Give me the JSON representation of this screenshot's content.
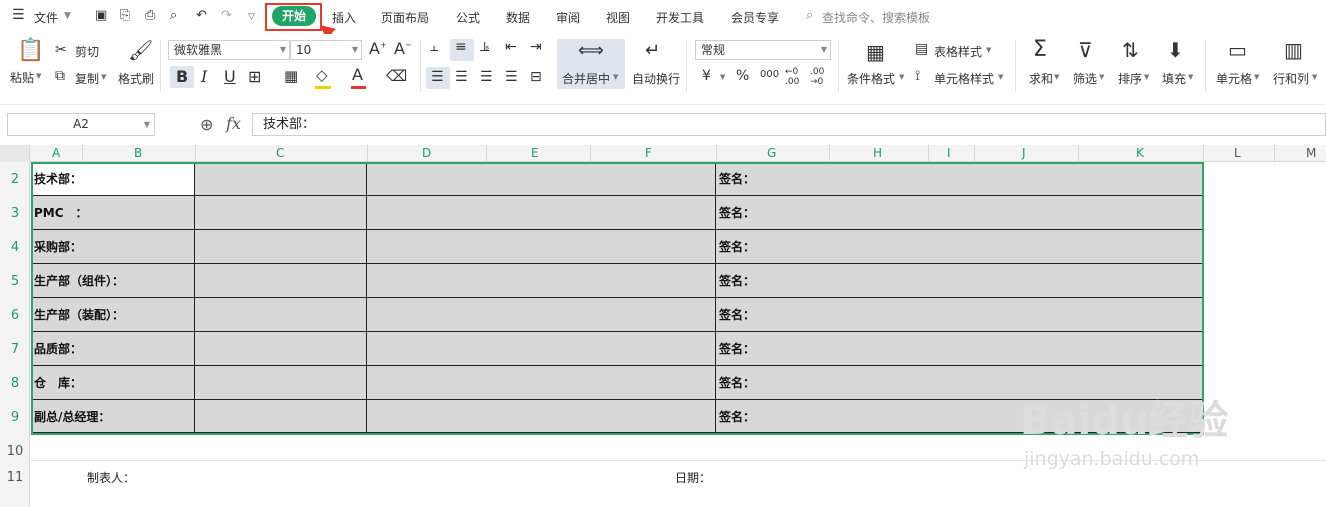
{
  "menubar": {
    "file": "文件",
    "tabs": [
      "开始",
      "插入",
      "页面布局",
      "公式",
      "数据",
      "审阅",
      "视图",
      "开发工具",
      "会员专享"
    ],
    "search_placeholder": "查找命令、搜索模板"
  },
  "ribbon": {
    "paste": "粘贴",
    "cut": "剪切",
    "copy": "复制",
    "format_painter": "格式刷",
    "font_name": "微软雅黑",
    "font_size": "10",
    "merge_center": "合并居中",
    "wrap_text": "自动换行",
    "number_format": "常规",
    "conditional_format": "条件格式",
    "table_style": "表格样式",
    "cell_style": "单元格样式",
    "sum": "求和",
    "filter": "筛选",
    "sort": "排序",
    "fill": "填充",
    "cell": "单元格",
    "rows_cols": "行和列",
    "currency": "¥",
    "percent": "%",
    "thousands": "000",
    "inc_decimal": "←0 .00",
    "dec_decimal": ".00 →0"
  },
  "formula_bar": {
    "name_box": "A2",
    "fx": "fx",
    "value": "技术部："
  },
  "columns": [
    "A",
    "B",
    "C",
    "D",
    "E",
    "F",
    "G",
    "H",
    "I",
    "J",
    "K",
    "L",
    "M"
  ],
  "rows": [
    "2",
    "3",
    "4",
    "5",
    "6",
    "7",
    "8",
    "9",
    "10",
    "11"
  ],
  "table": {
    "departments": [
      "技术部：",
      "PMC　：",
      "采购部：",
      "生产部（组件）：",
      "生产部（装配）：",
      "品质部：",
      "仓　库：",
      "副总/总经理："
    ],
    "sign_label": "签名："
  },
  "footer": {
    "maker": "制表人：",
    "date": "日期："
  },
  "watermark": {
    "logo": "Baidu经验",
    "url": "jingyan.baidu.com"
  },
  "colors": {
    "accent": "#1fa566",
    "highlight": "#e8372c",
    "selection": "#2fa56b"
  }
}
